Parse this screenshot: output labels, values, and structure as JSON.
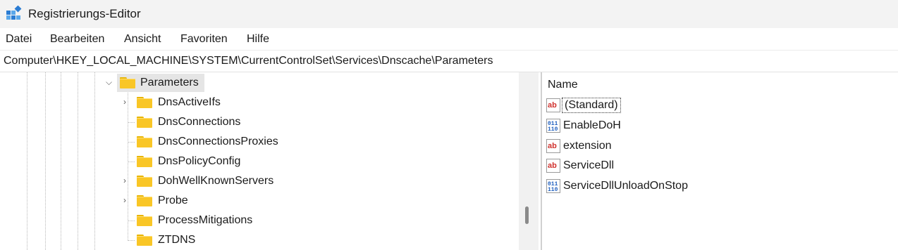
{
  "window": {
    "title": "Registrierungs-Editor"
  },
  "menu": [
    "Datei",
    "Bearbeiten",
    "Ansicht",
    "Favoriten",
    "Hilfe"
  ],
  "address": "Computer\\HKEY_LOCAL_MACHINE\\SYSTEM\\CurrentControlSet\\Services\\Dnscache\\Parameters",
  "tree": {
    "selected": "Parameters",
    "children": [
      {
        "label": "DnsActiveIfs",
        "expandable": true
      },
      {
        "label": "DnsConnections",
        "expandable": false
      },
      {
        "label": "DnsConnectionsProxies",
        "expandable": false
      },
      {
        "label": "DnsPolicyConfig",
        "expandable": false
      },
      {
        "label": "DohWellKnownServers",
        "expandable": true
      },
      {
        "label": "Probe",
        "expandable": true
      },
      {
        "label": "ProcessMitigations",
        "expandable": false
      },
      {
        "label": "ZTDNS",
        "expandable": false
      }
    ]
  },
  "values": {
    "column_header": "Name",
    "rows": [
      {
        "name": "(Standard)",
        "type": "string-icon"
      },
      {
        "name": "EnableDoH",
        "type": "binary-icon"
      },
      {
        "name": "extension",
        "type": "string-icon"
      },
      {
        "name": "ServiceDll",
        "type": "string-icon"
      },
      {
        "name": "ServiceDllUnloadOnStop",
        "type": "binary-icon"
      }
    ]
  }
}
